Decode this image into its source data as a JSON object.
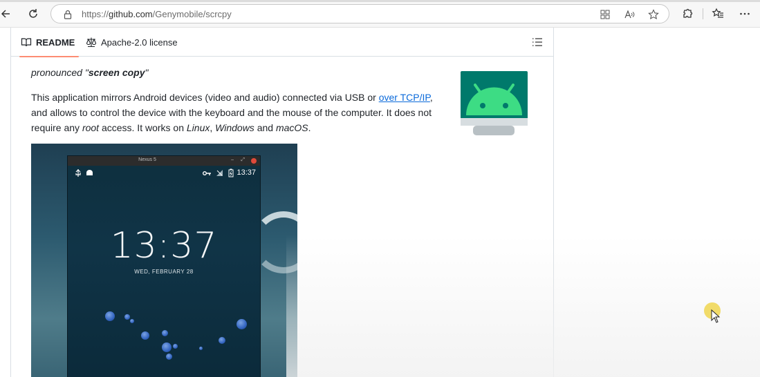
{
  "browser": {
    "url_prefix": "https://",
    "url_host": "github.com",
    "url_path": "/Genymobile/scrcpy",
    "icons": [
      "back-icon",
      "refresh-icon",
      "lock-icon",
      "app-available-icon",
      "read-aloud-icon",
      "favorite-icon",
      "extensions-icon",
      "favorites-icon",
      "more-icon"
    ]
  },
  "readme": {
    "tabs": [
      {
        "label": "README",
        "icon": "book-icon",
        "active": true
      },
      {
        "label": "Apache-2.0 license",
        "icon": "scale-icon",
        "active": false
      }
    ],
    "pronounced_prefix": "pronounced \"",
    "pronounced_term": "screen copy",
    "pronounced_suffix": "\"",
    "desc_part1": "This application mirrors Android devices (video and audio) connected via USB or ",
    "desc_link": "over TCP/IP",
    "desc_part2": ", and allows to control the device with the keyboard and the mouse of the computer. It does not require any ",
    "desc_root": "root",
    "desc_part3": " access. It works on ",
    "desc_linux": "Linux",
    "desc_sep1": ", ",
    "desc_windows": "Windows",
    "desc_and": " and ",
    "desc_macos": "macOS",
    "desc_end": "."
  },
  "screenshot": {
    "window_title": "Nexus 5",
    "status_time": "13:37",
    "clock": "13:37",
    "date": "WED, FEBRUARY 28"
  },
  "colors": {
    "link": "#0969da",
    "tab_underline": "#fd8c73",
    "android_green": "#3ddc84",
    "logo_teal": "#00796b"
  }
}
